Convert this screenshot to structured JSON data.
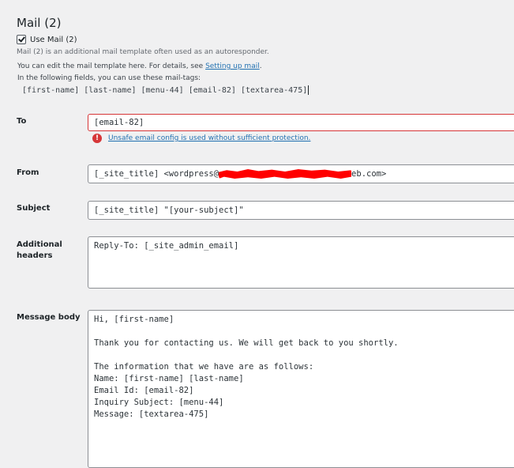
{
  "section": {
    "title": "Mail (2)",
    "use_label": "Use Mail (2)",
    "use_checked": true,
    "description": "Mail (2) is an additional mail template often used as an autoresponder.",
    "help_prefix": "You can edit the mail template here. For details, see ",
    "help_link": "Setting up mail",
    "help_suffix": ".",
    "tags_intro": "In the following fields, you can use these mail-tags:",
    "tags": "[first-name] [last-name] [menu-44] [email-82] [textarea-475]"
  },
  "fields": {
    "to": {
      "label": "To",
      "value": "[email-82]",
      "error": "Unsafe email config is used without sufficient protection."
    },
    "from": {
      "label": "From",
      "value_prefix": "[_site_title] <wordpress@",
      "value_suffix": "eb.com>"
    },
    "subject": {
      "label": "Subject",
      "value": "[_site_title] \"[your-subject]\""
    },
    "headers": {
      "label": "Additional headers",
      "value": "Reply-To: [_site_admin_email]"
    },
    "body": {
      "label": "Message body",
      "lines": [
        "Hi, [first-name]",
        "",
        "Thank you for contacting us. We will get back to you shortly.",
        "",
        "The information that we have are as follows:",
        "Name: [first-name] [last-name]",
        "Email Id: [email-82]",
        "Inquiry Subject: [menu-44]",
        "Message: [textarea-475]"
      ]
    }
  },
  "colors": {
    "accent": "#2271b1",
    "error": "#d63638",
    "redaction": "#ff0000"
  }
}
